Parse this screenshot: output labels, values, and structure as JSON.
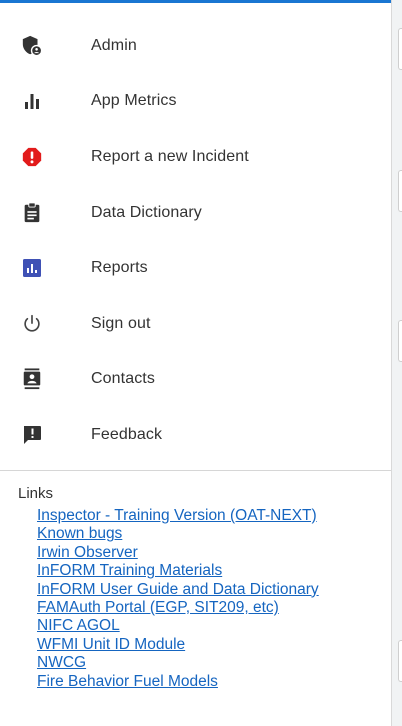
{
  "colors": {
    "accent": "#1976d2",
    "link": "#1565c0",
    "alert": "#e21b1b",
    "reports": "#3f51b5"
  },
  "menu": [
    {
      "label": "Admin",
      "icon": "admin-shield-icon"
    },
    {
      "label": "App Metrics",
      "icon": "bar-chart-icon"
    },
    {
      "label": "Report a new Incident",
      "icon": "alert-icon"
    },
    {
      "label": "Data Dictionary",
      "icon": "clipboard-icon"
    },
    {
      "label": "Reports",
      "icon": "reports-icon"
    },
    {
      "label": "Sign out",
      "icon": "power-icon"
    },
    {
      "label": "Contacts",
      "icon": "contacts-icon"
    },
    {
      "label": "Feedback",
      "icon": "feedback-icon"
    }
  ],
  "links": {
    "title": "Links",
    "items": [
      "Inspector - Training Version (OAT-NEXT)",
      "Known bugs",
      "Irwin Observer",
      "InFORM Training Materials",
      "InFORM User Guide and Data Dictionary",
      "FAMAuth Portal (EGP, SIT209, etc)",
      "NIFC AGOL",
      "WFMI Unit ID Module",
      "NWCG",
      "Fire Behavior Fuel Models"
    ]
  }
}
